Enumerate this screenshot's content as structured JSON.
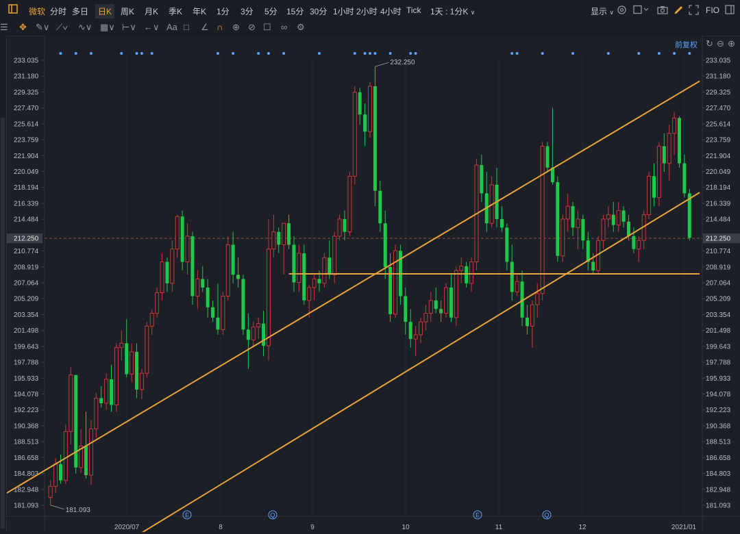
{
  "top_tabs": [
    {
      "label": "微软",
      "active": true
    },
    {
      "label": "分时"
    },
    {
      "label": "多日"
    },
    {
      "label": "日K",
      "active": true
    },
    {
      "label": "周K"
    },
    {
      "label": "月K"
    },
    {
      "label": "季K"
    },
    {
      "label": "年K"
    },
    {
      "label": "1分"
    },
    {
      "label": "3分"
    },
    {
      "label": "5分"
    },
    {
      "label": "15分"
    },
    {
      "label": "30分"
    },
    {
      "label": "1小时"
    },
    {
      "label": "2小时"
    },
    {
      "label": "4小时"
    },
    {
      "label": "Tick"
    },
    {
      "label": "1天 : 1分K"
    }
  ],
  "right_controls": {
    "display": "显示",
    "fio": "FIO",
    "adjust": "前复权"
  },
  "price_axis": [
    "233.035",
    "231.180",
    "229.325",
    "227.470",
    "225.614",
    "223.759",
    "221.904",
    "220.049",
    "218.194",
    "216.339",
    "214.484",
    "212.250",
    "210.774",
    "208.919",
    "207.064",
    "205.209",
    "203.354",
    "201.498",
    "199.643",
    "197.788",
    "195.933",
    "194.078",
    "192.223",
    "190.368",
    "188.513",
    "186.658",
    "184.803",
    "182.948",
    "181.093"
  ],
  "current_price": "212.250",
  "annotations": {
    "high": "232.250",
    "low": "181.093"
  },
  "x_labels": [
    "2020/07",
    "8",
    "9",
    "10",
    "11",
    "12",
    "2021/01"
  ],
  "event_markers": [
    {
      "symbol": "E"
    },
    {
      "symbol": "Q"
    },
    {
      "symbol": "E"
    },
    {
      "symbol": "Q"
    }
  ],
  "chart_data": {
    "type": "candlestick",
    "ylim": [
      180.0,
      234.0
    ],
    "colors": {
      "up": "#c8393b",
      "down": "#1fc84a",
      "trend": "#e8a33a"
    },
    "candles": [
      {
        "o": 182.0,
        "h": 184.0,
        "l": 181.1,
        "c": 183.3
      },
      {
        "o": 183.3,
        "h": 186.6,
        "l": 182.5,
        "c": 185.9
      },
      {
        "o": 185.9,
        "h": 187.0,
        "l": 183.6,
        "c": 184.0
      },
      {
        "o": 184.0,
        "h": 190.5,
        "l": 183.6,
        "c": 189.7
      },
      {
        "o": 189.7,
        "h": 197.2,
        "l": 188.2,
        "c": 196.3
      },
      {
        "o": 196.3,
        "h": 193.0,
        "l": 184.8,
        "c": 185.5
      },
      {
        "o": 185.5,
        "h": 190.0,
        "l": 184.9,
        "c": 188.0
      },
      {
        "o": 188.0,
        "h": 192.0,
        "l": 184.2,
        "c": 184.6
      },
      {
        "o": 184.6,
        "h": 191.0,
        "l": 183.5,
        "c": 190.0
      },
      {
        "o": 190.0,
        "h": 194.2,
        "l": 189.0,
        "c": 193.6
      },
      {
        "o": 193.6,
        "h": 195.0,
        "l": 192.5,
        "c": 193.0
      },
      {
        "o": 193.0,
        "h": 196.5,
        "l": 192.2,
        "c": 195.8
      },
      {
        "o": 195.8,
        "h": 197.5,
        "l": 192.0,
        "c": 192.8
      },
      {
        "o": 192.8,
        "h": 200.0,
        "l": 192.0,
        "c": 199.5
      },
      {
        "o": 199.5,
        "h": 201.5,
        "l": 198.0,
        "c": 200.0
      },
      {
        "o": 200.0,
        "h": 202.8,
        "l": 196.0,
        "c": 196.4
      },
      {
        "o": 196.4,
        "h": 200.0,
        "l": 195.5,
        "c": 199.0
      },
      {
        "o": 199.0,
        "h": 200.0,
        "l": 193.6,
        "c": 194.6
      },
      {
        "o": 194.6,
        "h": 197.0,
        "l": 193.5,
        "c": 196.5
      },
      {
        "o": 196.5,
        "h": 202.5,
        "l": 196.0,
        "c": 202.0
      },
      {
        "o": 202.0,
        "h": 204.0,
        "l": 201.0,
        "c": 203.5
      },
      {
        "o": 203.5,
        "h": 206.5,
        "l": 203.0,
        "c": 205.9
      },
      {
        "o": 205.9,
        "h": 210.5,
        "l": 205.0,
        "c": 209.5
      },
      {
        "o": 209.5,
        "h": 210.0,
        "l": 206.0,
        "c": 207.0
      },
      {
        "o": 207.0,
        "h": 212.0,
        "l": 206.0,
        "c": 211.0
      },
      {
        "o": 211.0,
        "h": 215.0,
        "l": 210.0,
        "c": 214.8
      },
      {
        "o": 214.8,
        "h": 215.5,
        "l": 208.5,
        "c": 209.5
      },
      {
        "o": 209.5,
        "h": 214.0,
        "l": 208.0,
        "c": 212.5
      },
      {
        "o": 212.5,
        "h": 213.0,
        "l": 204.5,
        "c": 205.5
      },
      {
        "o": 205.5,
        "h": 208.5,
        "l": 204.0,
        "c": 207.5
      },
      {
        "o": 207.5,
        "h": 209.0,
        "l": 206.0,
        "c": 206.5
      },
      {
        "o": 206.5,
        "h": 207.5,
        "l": 203.0,
        "c": 204.2
      },
      {
        "o": 204.2,
        "h": 205.0,
        "l": 202.5,
        "c": 203.0
      },
      {
        "o": 203.0,
        "h": 207.0,
        "l": 201.0,
        "c": 201.6
      },
      {
        "o": 201.6,
        "h": 206.0,
        "l": 201.0,
        "c": 205.5
      },
      {
        "o": 205.5,
        "h": 212.5,
        "l": 205.0,
        "c": 211.5
      },
      {
        "o": 211.5,
        "h": 213.0,
        "l": 207.0,
        "c": 208.0
      },
      {
        "o": 208.0,
        "h": 210.0,
        "l": 206.5,
        "c": 207.5
      },
      {
        "o": 207.5,
        "h": 208.0,
        "l": 201.0,
        "c": 201.6
      },
      {
        "o": 201.6,
        "h": 203.5,
        "l": 197.0,
        "c": 200.4
      },
      {
        "o": 200.4,
        "h": 202.5,
        "l": 199.5,
        "c": 201.9
      },
      {
        "o": 201.9,
        "h": 203.0,
        "l": 200.5,
        "c": 202.3
      },
      {
        "o": 202.3,
        "h": 203.8,
        "l": 198.5,
        "c": 199.7
      },
      {
        "o": 199.7,
        "h": 214.5,
        "l": 198.0,
        "c": 211.0
      },
      {
        "o": 211.0,
        "h": 215.0,
        "l": 210.0,
        "c": 213.0
      },
      {
        "o": 213.0,
        "h": 213.5,
        "l": 210.5,
        "c": 211.5
      },
      {
        "o": 211.5,
        "h": 214.0,
        "l": 208.0,
        "c": 214.0
      },
      {
        "o": 214.0,
        "h": 215.0,
        "l": 211.0,
        "c": 211.5
      },
      {
        "o": 211.5,
        "h": 212.5,
        "l": 206.0,
        "c": 207.1
      },
      {
        "o": 207.1,
        "h": 211.5,
        "l": 206.0,
        "c": 210.5
      },
      {
        "o": 210.5,
        "h": 211.5,
        "l": 204.5,
        "c": 205.0
      },
      {
        "o": 205.0,
        "h": 206.8,
        "l": 203.0,
        "c": 206.5
      },
      {
        "o": 206.5,
        "h": 208.0,
        "l": 205.0,
        "c": 207.5
      },
      {
        "o": 207.5,
        "h": 208.5,
        "l": 206.0,
        "c": 207.0
      },
      {
        "o": 207.0,
        "h": 210.5,
        "l": 206.5,
        "c": 210.0
      },
      {
        "o": 210.0,
        "h": 212.0,
        "l": 207.5,
        "c": 208.0
      },
      {
        "o": 208.0,
        "h": 213.0,
        "l": 207.0,
        "c": 212.5
      },
      {
        "o": 212.5,
        "h": 215.0,
        "l": 212.0,
        "c": 214.5
      },
      {
        "o": 214.5,
        "h": 215.5,
        "l": 212.0,
        "c": 213.0
      },
      {
        "o": 213.0,
        "h": 220.0,
        "l": 212.5,
        "c": 219.5
      },
      {
        "o": 219.5,
        "h": 230.0,
        "l": 218.5,
        "c": 229.3
      },
      {
        "o": 229.3,
        "h": 229.8,
        "l": 225.5,
        "c": 226.7
      },
      {
        "o": 226.7,
        "h": 228.0,
        "l": 223.0,
        "c": 224.7
      },
      {
        "o": 224.7,
        "h": 230.5,
        "l": 224.0,
        "c": 230.0
      },
      {
        "o": 230.0,
        "h": 232.3,
        "l": 216.0,
        "c": 217.8
      },
      {
        "o": 217.8,
        "h": 219.0,
        "l": 213.0,
        "c": 214.0
      },
      {
        "o": 214.0,
        "h": 215.5,
        "l": 207.5,
        "c": 208.9
      },
      {
        "o": 208.9,
        "h": 210.5,
        "l": 202.5,
        "c": 203.4
      },
      {
        "o": 203.4,
        "h": 211.5,
        "l": 203.0,
        "c": 210.8
      },
      {
        "o": 210.8,
        "h": 211.5,
        "l": 204.5,
        "c": 205.5
      },
      {
        "o": 205.5,
        "h": 206.5,
        "l": 201.0,
        "c": 202.5
      },
      {
        "o": 202.5,
        "h": 204.0,
        "l": 199.5,
        "c": 200.5
      },
      {
        "o": 200.5,
        "h": 202.0,
        "l": 198.5,
        "c": 201.0
      },
      {
        "o": 201.0,
        "h": 203.0,
        "l": 200.0,
        "c": 202.5
      },
      {
        "o": 202.5,
        "h": 204.5,
        "l": 201.5,
        "c": 203.5
      },
      {
        "o": 203.5,
        "h": 206.0,
        "l": 202.5,
        "c": 205.0
      },
      {
        "o": 205.0,
        "h": 206.5,
        "l": 203.5,
        "c": 204.0
      },
      {
        "o": 204.0,
        "h": 205.0,
        "l": 202.5,
        "c": 203.5
      },
      {
        "o": 203.5,
        "h": 207.0,
        "l": 203.0,
        "c": 206.5
      },
      {
        "o": 206.5,
        "h": 208.0,
        "l": 202.5,
        "c": 203.0
      },
      {
        "o": 203.0,
        "h": 209.0,
        "l": 202.0,
        "c": 208.5
      },
      {
        "o": 208.5,
        "h": 210.0,
        "l": 207.0,
        "c": 209.0
      },
      {
        "o": 209.0,
        "h": 209.5,
        "l": 206.5,
        "c": 207.0
      },
      {
        "o": 207.0,
        "h": 210.0,
        "l": 206.0,
        "c": 209.5
      },
      {
        "o": 209.5,
        "h": 221.5,
        "l": 208.5,
        "c": 220.8
      },
      {
        "o": 220.8,
        "h": 222.0,
        "l": 216.5,
        "c": 217.5
      },
      {
        "o": 217.5,
        "h": 220.0,
        "l": 213.0,
        "c": 214.0
      },
      {
        "o": 214.0,
        "h": 219.5,
        "l": 213.5,
        "c": 218.5
      },
      {
        "o": 218.5,
        "h": 220.5,
        "l": 213.5,
        "c": 214.5
      },
      {
        "o": 214.5,
        "h": 216.0,
        "l": 213.0,
        "c": 213.5
      },
      {
        "o": 213.5,
        "h": 214.0,
        "l": 208.5,
        "c": 209.5
      },
      {
        "o": 209.5,
        "h": 211.5,
        "l": 205.0,
        "c": 206.0
      },
      {
        "o": 206.0,
        "h": 208.0,
        "l": 205.5,
        "c": 207.2
      },
      {
        "o": 207.2,
        "h": 208.5,
        "l": 202.0,
        "c": 203.0
      },
      {
        "o": 203.0,
        "h": 204.5,
        "l": 201.0,
        "c": 202.0
      },
      {
        "o": 202.0,
        "h": 205.0,
        "l": 199.5,
        "c": 204.5
      },
      {
        "o": 204.5,
        "h": 207.0,
        "l": 203.0,
        "c": 205.8
      },
      {
        "o": 205.8,
        "h": 223.5,
        "l": 205.0,
        "c": 223.0
      },
      {
        "o": 223.0,
        "h": 223.5,
        "l": 220.0,
        "c": 220.5
      },
      {
        "o": 220.5,
        "h": 227.5,
        "l": 218.5,
        "c": 218.8
      },
      {
        "o": 218.8,
        "h": 219.5,
        "l": 209.5,
        "c": 210.2
      },
      {
        "o": 210.2,
        "h": 215.0,
        "l": 209.5,
        "c": 214.5
      },
      {
        "o": 214.5,
        "h": 217.5,
        "l": 213.0,
        "c": 216.0
      },
      {
        "o": 216.0,
        "h": 216.5,
        "l": 212.5,
        "c": 213.5
      },
      {
        "o": 213.5,
        "h": 215.5,
        "l": 211.0,
        "c": 214.5
      },
      {
        "o": 214.5,
        "h": 215.0,
        "l": 211.0,
        "c": 212.0
      },
      {
        "o": 212.0,
        "h": 213.0,
        "l": 208.5,
        "c": 209.5
      },
      {
        "o": 209.5,
        "h": 210.5,
        "l": 208.0,
        "c": 208.5
      },
      {
        "o": 208.5,
        "h": 212.5,
        "l": 208.0,
        "c": 212.0
      },
      {
        "o": 212.0,
        "h": 215.0,
        "l": 211.0,
        "c": 214.5
      },
      {
        "o": 214.5,
        "h": 216.0,
        "l": 213.5,
        "c": 215.0
      },
      {
        "o": 215.0,
        "h": 216.5,
        "l": 213.0,
        "c": 213.8
      },
      {
        "o": 213.8,
        "h": 216.5,
        "l": 213.0,
        "c": 215.5
      },
      {
        "o": 215.5,
        "h": 216.0,
        "l": 213.5,
        "c": 214.2
      },
      {
        "o": 214.2,
        "h": 215.0,
        "l": 212.0,
        "c": 212.5
      },
      {
        "o": 212.5,
        "h": 213.5,
        "l": 210.5,
        "c": 211.0
      },
      {
        "o": 211.0,
        "h": 212.5,
        "l": 209.5,
        "c": 212.0
      },
      {
        "o": 212.0,
        "h": 215.5,
        "l": 211.0,
        "c": 215.0
      },
      {
        "o": 215.0,
        "h": 220.0,
        "l": 214.5,
        "c": 219.5
      },
      {
        "o": 219.5,
        "h": 221.0,
        "l": 216.0,
        "c": 217.0
      },
      {
        "o": 217.0,
        "h": 223.5,
        "l": 216.0,
        "c": 223.0
      },
      {
        "o": 223.0,
        "h": 224.5,
        "l": 220.0,
        "c": 221.0
      },
      {
        "o": 221.0,
        "h": 225.5,
        "l": 219.0,
        "c": 224.5
      },
      {
        "o": 224.5,
        "h": 227.0,
        "l": 222.0,
        "c": 226.3
      },
      {
        "o": 226.3,
        "h": 226.5,
        "l": 220.5,
        "c": 221.0
      },
      {
        "o": 221.0,
        "h": 222.0,
        "l": 217.0,
        "c": 217.5
      },
      {
        "o": 217.5,
        "h": 218.0,
        "l": 212.0,
        "c": 212.3
      }
    ],
    "trendlines": [
      {
        "from": {
          "i": -30,
          "p": 175.0
        },
        "to": {
          "i": 128,
          "p": 230.6
        }
      },
      {
        "from": {
          "i": 10,
          "p": 175.0
        },
        "to": {
          "i": 128,
          "p": 217.6
        }
      },
      {
        "from": {
          "i": 47,
          "p": 208.1
        },
        "to": {
          "i": 128,
          "p": 208.1
        }
      }
    ]
  }
}
